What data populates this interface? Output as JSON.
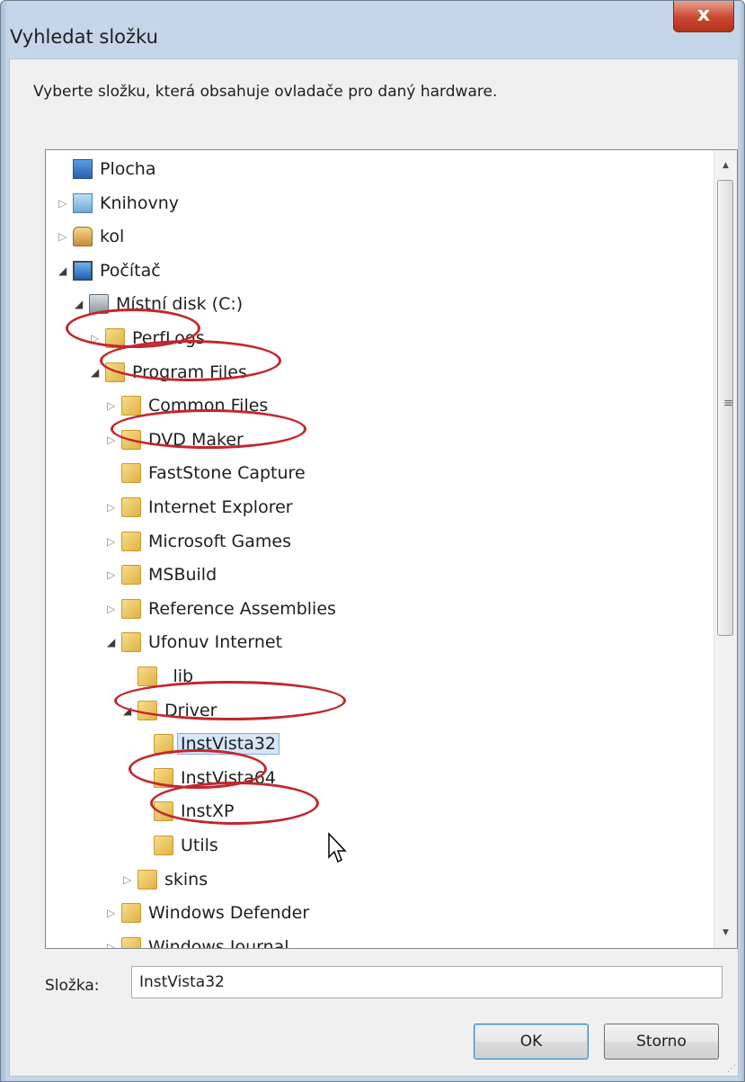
{
  "window": {
    "title": "Vyhledat složku",
    "close_glyph": "x"
  },
  "description": "Vyberte složku, která obsahuje ovladače pro daný hardware.",
  "tree": {
    "items": [
      {
        "label": "Plocha",
        "icon": "desktop-icon",
        "expander": "none"
      },
      {
        "label": "Knihovny",
        "icon": "libraries-icon",
        "expander": "collapsed"
      },
      {
        "label": "kol",
        "icon": "user-icon",
        "expander": "collapsed"
      },
      {
        "label": "Počítač",
        "icon": "computer-icon",
        "expander": "expanded"
      },
      {
        "label": "Místní disk (C:)",
        "icon": "drive-icon",
        "expander": "expanded"
      },
      {
        "label": "PerfLogs",
        "icon": "folder-icon",
        "expander": "collapsed"
      },
      {
        "label": "Program Files",
        "icon": "folder-icon",
        "expander": "expanded"
      },
      {
        "label": "Common Files",
        "icon": "folder-icon",
        "expander": "collapsed"
      },
      {
        "label": "DVD Maker",
        "icon": "folder-icon",
        "expander": "collapsed"
      },
      {
        "label": "FastStone Capture",
        "icon": "folder-icon",
        "expander": "none"
      },
      {
        "label": "Internet Explorer",
        "icon": "folder-icon",
        "expander": "collapsed"
      },
      {
        "label": "Microsoft Games",
        "icon": "folder-icon",
        "expander": "collapsed"
      },
      {
        "label": "MSBuild",
        "icon": "folder-icon",
        "expander": "collapsed"
      },
      {
        "label": "Reference Assemblies",
        "icon": "folder-icon",
        "expander": "collapsed"
      },
      {
        "label": "Ufonuv Internet",
        "icon": "folder-icon",
        "expander": "expanded"
      },
      {
        "label": "_lib",
        "icon": "folder-icon",
        "expander": "none"
      },
      {
        "label": "Driver",
        "icon": "folder-icon",
        "expander": "expanded"
      },
      {
        "label": "InstVista32",
        "icon": "folder-icon",
        "expander": "none",
        "selected": true
      },
      {
        "label": "InstVista64",
        "icon": "folder-icon",
        "expander": "none"
      },
      {
        "label": "InstXP",
        "icon": "folder-icon",
        "expander": "none"
      },
      {
        "label": "Utils",
        "icon": "folder-icon",
        "expander": "none"
      },
      {
        "label": "skins",
        "icon": "folder-icon",
        "expander": "collapsed"
      },
      {
        "label": "Windows Defender",
        "icon": "folder-icon",
        "expander": "collapsed"
      },
      {
        "label": "Windows Journal",
        "icon": "folder-icon",
        "expander": "collapsed"
      }
    ]
  },
  "folder_field": {
    "label": "Složka:",
    "value": "InstVista32"
  },
  "buttons": {
    "ok": "OK",
    "cancel": "Storno"
  },
  "colors": {
    "annotation_ring": "#c2262e",
    "selection": "#d5e6fb"
  }
}
